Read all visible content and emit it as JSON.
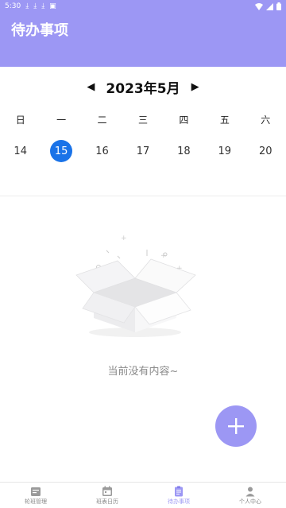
{
  "status_bar": {
    "time": "5:30"
  },
  "header": {
    "title": "待办事项"
  },
  "calendar": {
    "prev_icon": "triangle-left-icon",
    "next_icon": "triangle-right-icon",
    "month_label": "2023年5月",
    "weekdays": [
      "日",
      "一",
      "二",
      "三",
      "四",
      "五",
      "六"
    ],
    "days": [
      "14",
      "15",
      "16",
      "17",
      "18",
      "19",
      "20"
    ],
    "selected_day": "15"
  },
  "empty_state": {
    "icon": "empty-box-icon",
    "text": "当前没有内容~"
  },
  "fab": {
    "icon": "plus-icon"
  },
  "tabbar": {
    "items": [
      {
        "label": "轮班管理",
        "icon": "shift-icon"
      },
      {
        "label": "班表日历",
        "icon": "calendar-icon"
      },
      {
        "label": "待办事项",
        "icon": "clipboard-icon"
      },
      {
        "label": "个人中心",
        "icon": "person-icon"
      }
    ],
    "active_index": 2
  },
  "colors": {
    "accent": "#9c97f4",
    "selected_day": "#1a73e8"
  }
}
